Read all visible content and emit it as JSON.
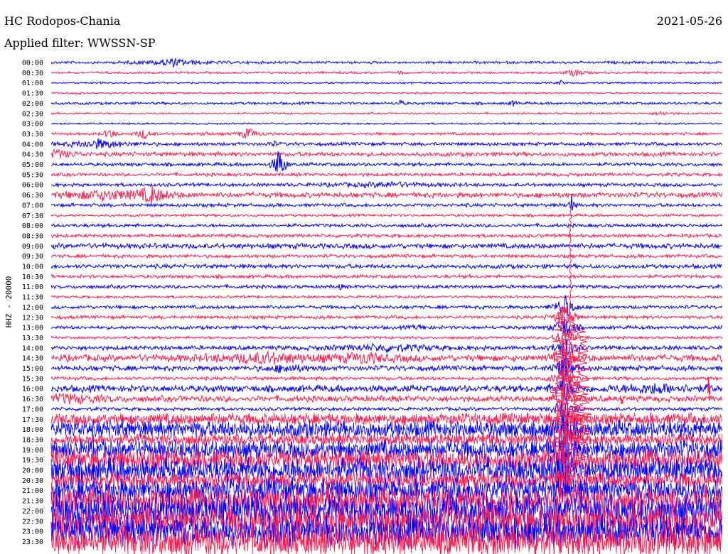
{
  "header": {
    "station": "HC Rodopos-Chania",
    "date": "2021-05-26",
    "filter": "Applied filter: WWSSN-SP"
  },
  "chart_data": {
    "type": "line",
    "title": "HC Rodopos-Chania",
    "ylabel": "HHZ - 20000",
    "colors": {
      "even": "#0000ff",
      "odd": "#ff1a4d"
    },
    "rows": [
      {
        "label": "00:00",
        "amp": 1.5,
        "events": [
          {
            "t": 0.18,
            "a": 5,
            "w": 0.03
          }
        ]
      },
      {
        "label": "00:30",
        "amp": 1.2,
        "events": [
          {
            "t": 0.78,
            "a": 5,
            "w": 0.01
          },
          {
            "t": 0.52,
            "a": 3,
            "w": 0.003
          }
        ]
      },
      {
        "label": "01:00",
        "amp": 1.0,
        "events": [
          {
            "t": 0.76,
            "a": 4,
            "w": 0.003
          }
        ]
      },
      {
        "label": "01:30",
        "amp": 1.0,
        "events": [
          {
            "t": 0.04,
            "a": 2,
            "w": 0.003
          }
        ]
      },
      {
        "label": "02:00",
        "amp": 1.5,
        "events": [
          {
            "t": 0.52,
            "a": 4,
            "w": 0.004
          },
          {
            "t": 0.69,
            "a": 4,
            "w": 0.004
          }
        ]
      },
      {
        "label": "02:30",
        "amp": 1.0,
        "events": [
          {
            "t": 0.91,
            "a": 3,
            "w": 0.01
          }
        ]
      },
      {
        "label": "03:00",
        "amp": 1.0,
        "events": []
      },
      {
        "label": "03:30",
        "amp": 1.5,
        "events": [
          {
            "t": 0.087,
            "a": 8,
            "w": 0.006
          },
          {
            "t": 0.138,
            "a": 7,
            "w": 0.008
          },
          {
            "t": 0.294,
            "a": 8,
            "w": 0.01
          },
          {
            "t": 0.23,
            "a": 3,
            "w": 0.005
          }
        ]
      },
      {
        "label": "04:00",
        "amp": 2,
        "events": [
          {
            "t": 0.07,
            "a": 6,
            "w": 0.03
          },
          {
            "t": 0.33,
            "a": 4,
            "w": 0.004
          }
        ]
      },
      {
        "label": "04:30",
        "amp": 2.5,
        "events": [
          {
            "t": 0.01,
            "a": 5,
            "w": 0.02
          }
        ]
      },
      {
        "label": "05:00",
        "amp": 2,
        "events": [
          {
            "t": 0.34,
            "a": 26,
            "w": 0.006
          }
        ]
      },
      {
        "label": "05:30",
        "amp": 2,
        "events": []
      },
      {
        "label": "06:00",
        "amp": 2,
        "events": [
          {
            "t": 0.5,
            "a": 3,
            "w": 0.05
          }
        ]
      },
      {
        "label": "06:30",
        "amp": 3,
        "events": [
          {
            "t": 0.08,
            "a": 6,
            "w": 0.05
          },
          {
            "t": 0.15,
            "a": 10,
            "w": 0.015
          }
        ]
      },
      {
        "label": "07:00",
        "amp": 2,
        "events": [
          {
            "t": 0.775,
            "a": 18,
            "w": 0.003
          }
        ]
      },
      {
        "label": "07:30",
        "amp": 1.5,
        "events": []
      },
      {
        "label": "08:00",
        "amp": 2,
        "events": []
      },
      {
        "label": "08:30",
        "amp": 2,
        "events": []
      },
      {
        "label": "09:00",
        "amp": 3,
        "events": []
      },
      {
        "label": "09:30",
        "amp": 2,
        "events": []
      },
      {
        "label": "10:00",
        "amp": 2.5,
        "events": []
      },
      {
        "label": "10:30",
        "amp": 2,
        "events": []
      },
      {
        "label": "11:00",
        "amp": 2,
        "events": [
          {
            "t": 0.43,
            "a": 4,
            "w": 0.003
          }
        ]
      },
      {
        "label": "11:30",
        "amp": 1.5,
        "events": []
      },
      {
        "label": "12:00",
        "amp": 2,
        "events": []
      },
      {
        "label": "12:30",
        "amp": 2,
        "events": []
      },
      {
        "label": "13:00",
        "amp": 2,
        "events": [
          {
            "t": 0.55,
            "a": 3,
            "w": 0.01
          }
        ]
      },
      {
        "label": "13:30",
        "amp": 1.5,
        "events": []
      },
      {
        "label": "14:00",
        "amp": 2.5,
        "events": [
          {
            "t": 0.5,
            "a": 4,
            "w": 0.06
          }
        ]
      },
      {
        "label": "14:30",
        "amp": 4,
        "events": [
          {
            "t": 0.32,
            "a": 6,
            "w": 0.06
          },
          {
            "t": 0.47,
            "a": 5,
            "w": 0.03
          }
        ]
      },
      {
        "label": "15:00",
        "amp": 3,
        "events": [
          {
            "t": 0.35,
            "a": 5,
            "w": 0.02
          }
        ]
      },
      {
        "label": "15:30",
        "amp": 2,
        "events": []
      },
      {
        "label": "16:00",
        "amp": 4,
        "events": [
          {
            "t": 0.9,
            "a": 5,
            "w": 0.05
          }
        ]
      },
      {
        "label": "16:30",
        "amp": 3.5,
        "events": [
          {
            "t": 0.03,
            "a": 5,
            "w": 0.04
          }
        ]
      },
      {
        "label": "17:00",
        "amp": 2,
        "events": []
      },
      {
        "label": "17:30",
        "amp": 7,
        "events": []
      },
      {
        "label": "18:00",
        "amp": 10,
        "events": []
      },
      {
        "label": "18:30",
        "amp": 7,
        "events": []
      },
      {
        "label": "19:00",
        "amp": 11,
        "events": []
      },
      {
        "label": "19:30",
        "amp": 12,
        "events": []
      },
      {
        "label": "20:00",
        "amp": 14,
        "events": []
      },
      {
        "label": "20:30",
        "amp": 10,
        "events": []
      },
      {
        "label": "21:00",
        "amp": 14,
        "events": []
      },
      {
        "label": "21:30",
        "amp": 16,
        "events": []
      },
      {
        "label": "22:00",
        "amp": 18,
        "events": []
      },
      {
        "label": "22:30",
        "amp": 18,
        "events": []
      },
      {
        "label": "23:00",
        "amp": 18,
        "events": []
      },
      {
        "label": "23:30",
        "amp": 18,
        "events": []
      }
    ],
    "major_event": {
      "start_row": "12:00",
      "end_row": "20:30",
      "t": 0.765,
      "peaks": [
        0.76,
        0.775,
        0.79
      ]
    },
    "extra_spikes": [
      {
        "row": "16:00",
        "t": 0.98,
        "a": 18
      },
      {
        "row": "16:30",
        "t": 0.85,
        "a": 10
      }
    ]
  }
}
